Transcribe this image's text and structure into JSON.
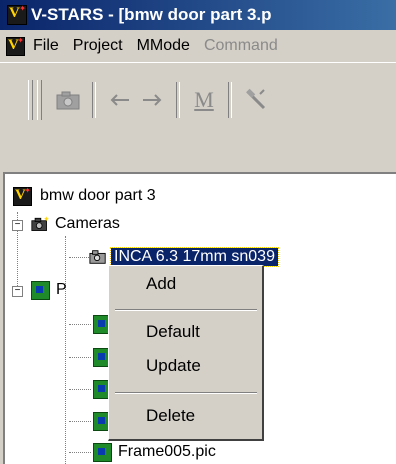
{
  "window": {
    "title": "V-STARS - [bmw door part 3.p"
  },
  "menubar": {
    "items": [
      {
        "label": "File",
        "enabled": true
      },
      {
        "label": "Project",
        "enabled": true
      },
      {
        "label": "MMode",
        "enabled": true
      },
      {
        "label": "Command",
        "enabled": false
      }
    ]
  },
  "toolbar": {
    "buttons": [
      {
        "icon": "camera-icon",
        "enabled": false
      },
      {
        "icon": "arrow-left-icon",
        "enabled": false
      },
      {
        "icon": "arrow-right-icon",
        "enabled": false
      },
      {
        "icon": "m-icon",
        "label": "M",
        "enabled": false
      },
      {
        "icon": "hammer-icon",
        "enabled": false
      }
    ]
  },
  "tree": {
    "root": {
      "label": "bmw door part 3"
    },
    "cameras": {
      "label": "Cameras",
      "expanded": true
    },
    "camera_item": {
      "label": "INCA 6.3 17mm sn039",
      "selected": true
    },
    "pictures": {
      "label": "P",
      "expanded": true
    },
    "last_frame": {
      "label": "Frame005.pic"
    }
  },
  "context_menu": {
    "items": [
      {
        "label": "Add"
      },
      {
        "label": "Default"
      },
      {
        "label": "Update"
      },
      {
        "label": "Delete"
      }
    ]
  },
  "colors": {
    "titlebar_start": "#0a246a",
    "titlebar_end": "#3a6ea5",
    "selection": "#0a246a",
    "face": "#d4d0c8",
    "frame_icon": "#1f8a2a"
  }
}
